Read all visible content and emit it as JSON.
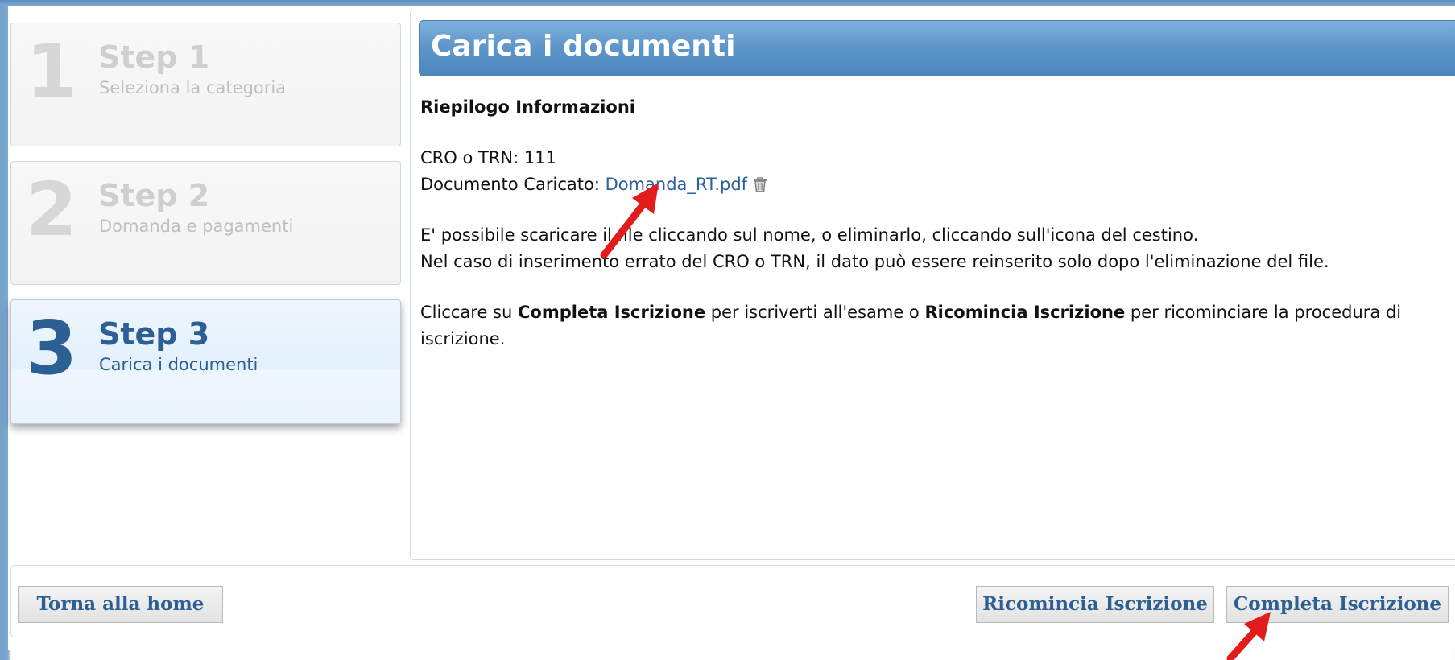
{
  "steps": [
    {
      "number": "1",
      "title": "Step 1",
      "subtitle": "Seleziona la categoria",
      "active": false
    },
    {
      "number": "2",
      "title": "Step 2",
      "subtitle": "Domanda e pagamenti",
      "active": false
    },
    {
      "number": "3",
      "title": "Step 3",
      "subtitle": "Carica i documenti",
      "active": true
    }
  ],
  "panel": {
    "title": "Carica i documenti",
    "heading": "Riepilogo Informazioni",
    "cro_label": "CRO o TRN: ",
    "cro_value": "111",
    "doc_label": "Documento Caricato: ",
    "doc_link": "Domanda_RT.pdf",
    "info_line1": "E' possibile scaricare il file cliccando sul nome, o eliminarlo, cliccando sull'icona del cestino.",
    "info_line2": "Nel caso di inserimento errato del CRO o TRN, il dato può essere reinserito solo dopo l'eliminazione del file.",
    "instr_prefix": "Cliccare su ",
    "instr_complete": "Completa Iscrizione",
    "instr_mid": " per iscriverti all'esame o ",
    "instr_restart": "Ricomincia Iscrizione",
    "instr_suffix": " per ricominciare la procedura di iscrizione."
  },
  "buttons": {
    "home": "Torna alla home",
    "restart": "Ricomincia Iscrizione",
    "complete": "Completa Iscrizione"
  },
  "colors": {
    "accent": "#2c5f93",
    "header_blue": "#5c95c9",
    "arrow_red": "#e21b1b"
  },
  "icons": {
    "trash": "trash-icon"
  }
}
